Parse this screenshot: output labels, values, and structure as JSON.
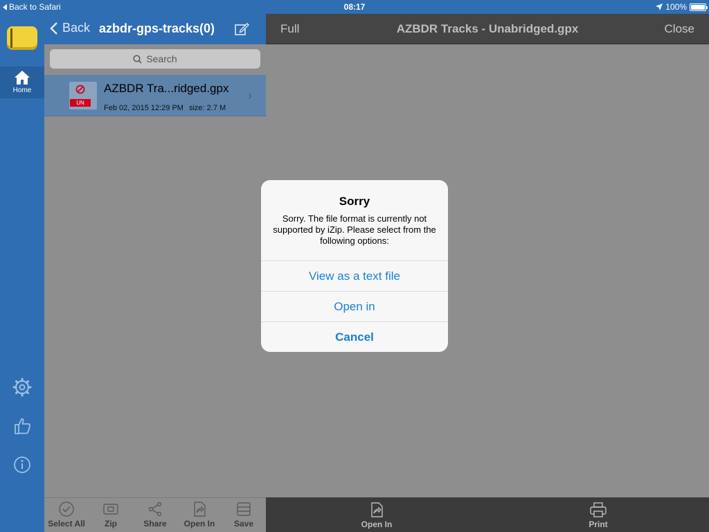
{
  "status_bar": {
    "back_app": "Back to Safari",
    "time": "08:17",
    "battery": "100%",
    "battery_level": 1.0
  },
  "rail": {
    "home_label": "Home"
  },
  "left_nav": {
    "back_label": "Back",
    "title": "azbdr-gps-tracks(0)"
  },
  "search": {
    "placeholder": "Search"
  },
  "file": {
    "name": "AZBDR Tra...ridged.gpx",
    "badge": "UN",
    "date": "Feb 02, 2015 12:29 PM",
    "size": "size: 2.7 M"
  },
  "left_toolbar": {
    "select_all": "Select All",
    "zip": "Zip",
    "share": "Share",
    "open_in": "Open In",
    "save": "Save"
  },
  "right_nav": {
    "full": "Full",
    "title": "AZBDR Tracks - Unabridged.gpx",
    "close": "Close"
  },
  "right_toolbar": {
    "open_in": "Open In",
    "print": "Print"
  },
  "alert": {
    "title": "Sorry",
    "message": "Sorry. The file format is currently not supported by iZip. Please select from the following options:",
    "view_text": "View as a text file",
    "open_in": "Open in",
    "cancel": "Cancel"
  },
  "colors": {
    "accent": "#2f6eb2",
    "alert_button": "#1a7fd6",
    "badge": "#d0021b"
  }
}
